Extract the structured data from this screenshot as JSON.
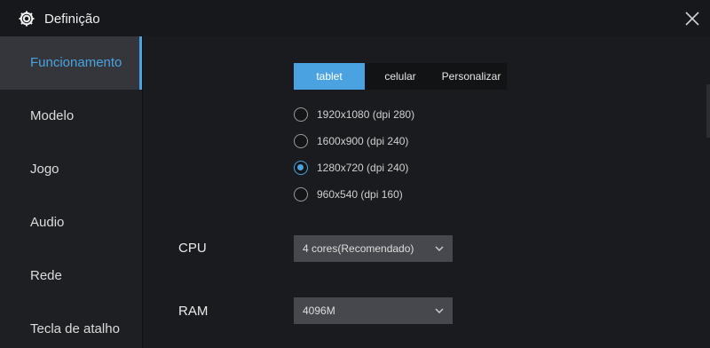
{
  "window": {
    "title": "Definição",
    "gear_icon": "gear-icon",
    "close_icon": "close-icon"
  },
  "sidebar": {
    "items": [
      {
        "label": "Funcionamento",
        "active": true
      },
      {
        "label": "Modelo",
        "active": false
      },
      {
        "label": "Jogo",
        "active": false
      },
      {
        "label": "Audio",
        "active": false
      },
      {
        "label": "Rede",
        "active": false
      },
      {
        "label": "Tecla de atalho",
        "active": false
      }
    ]
  },
  "resolution": {
    "tabs": [
      {
        "label": "tablet",
        "active": true
      },
      {
        "label": "celular",
        "active": false
      },
      {
        "label": "Personalizar",
        "active": false
      }
    ],
    "options": [
      {
        "label": "1920x1080  (dpi 280)",
        "checked": false
      },
      {
        "label": "1600x900  (dpi 240)",
        "checked": false
      },
      {
        "label": "1280x720  (dpi 240)",
        "checked": true
      },
      {
        "label": "960x540  (dpi 160)",
        "checked": false
      }
    ]
  },
  "cpu": {
    "label": "CPU",
    "value": "4 cores(Recomendado)"
  },
  "ram": {
    "label": "RAM",
    "value": "4096M"
  },
  "colors": {
    "accent": "#4aa3e0",
    "background": "#1a1b1e",
    "sidebar": "#1e1f22",
    "select": "#46484d"
  }
}
